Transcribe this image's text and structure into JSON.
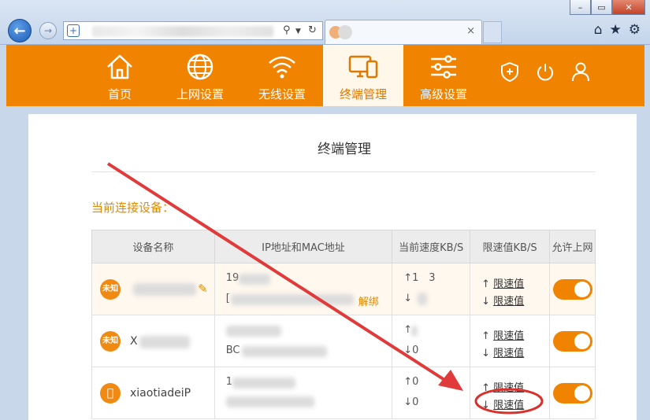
{
  "browser": {
    "window_buttons": [
      "–",
      "▭",
      "✕"
    ],
    "tab_close": "×"
  },
  "router": {
    "nav": [
      {
        "label": "首页",
        "icon": "home-icon"
      },
      {
        "label": "上网设置",
        "icon": "globe-icon"
      },
      {
        "label": "无线设置",
        "icon": "wifi-icon"
      },
      {
        "label": "终端管理",
        "icon": "devices-icon",
        "active": true
      },
      {
        "label": "高级设置",
        "icon": "sliders-icon"
      }
    ],
    "accent": "#f08300"
  },
  "page": {
    "title": "终端管理",
    "section_label": "当前连接设备：",
    "table": {
      "headers": [
        "设备名称",
        "IP地址和MAC地址",
        "当前速度KB/S",
        "限速值KB/S",
        "允许上网"
      ],
      "rows": [
        {
          "badge": "未知",
          "name": "",
          "ip": "19",
          "mac": "[",
          "unbind": "解绑",
          "up": "↑1",
          "up_suffix": "3",
          "down": "↓",
          "limit_up": "↑",
          "limit_down": "↓",
          "limit_label": "限速值",
          "allowed": true
        },
        {
          "badge": "未知",
          "name": "X",
          "ip": "",
          "mac": "BC",
          "up": "↑",
          "down": "↓0",
          "limit_up": "↑",
          "limit_down": "↓",
          "limit_label": "限速值",
          "allowed": true
        },
        {
          "badge": "apple",
          "name": "xiaotiadeiP",
          "ip": "1",
          "mac": "",
          "up": "↑0",
          "down": "↓0",
          "limit_up": "↑",
          "limit_down": "↓",
          "limit_label": "限速值",
          "allowed": true
        }
      ]
    }
  }
}
